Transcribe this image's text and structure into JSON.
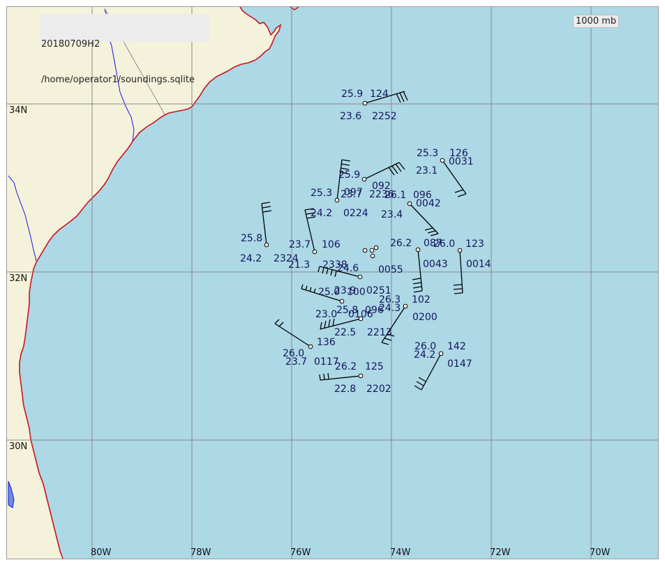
{
  "header": {
    "date_line": "20180709H2",
    "file_path": "/home/operator1/soundings.sqlite"
  },
  "level": "1000 mb",
  "colors": {
    "ocean": "#add8e6",
    "land": "#f5f2dc",
    "coast": "#c8141e",
    "river": "#1414e6",
    "grid": "#888888",
    "station_text": "#14145e",
    "wind_barb": "#000000"
  },
  "map": {
    "lon_labels": [
      "80W",
      "78W",
      "76W",
      "74W",
      "72W",
      "70W"
    ],
    "lat_labels": [
      "34N",
      "32N",
      "30N"
    ]
  },
  "stations": [
    {
      "temp": "25.9",
      "dew": "23.6",
      "code": "124",
      "time": "2252"
    },
    {
      "temp": "25.3",
      "dew": "23.1",
      "code": "126",
      "time": "0031"
    },
    {
      "temp": "25.9",
      "dew": "",
      "code": "092",
      "time": "2236"
    },
    {
      "temp": "25.3",
      "dew": "23.7",
      "code": "097",
      "time": ""
    },
    {
      "temp": "",
      "dew": "24.2",
      "code": "",
      "time": "0224"
    },
    {
      "temp": "26.1",
      "dew": "23.4",
      "code": "096",
      "time": "0042"
    },
    {
      "temp": "25.8",
      "dew": "24.2",
      "code": "",
      "time": "2324"
    },
    {
      "temp": "23.7",
      "dew": "21.3",
      "code": "106",
      "time": "2338"
    },
    {
      "temp": "26.2",
      "dew": "",
      "code": "087",
      "time": "0043"
    },
    {
      "temp": "26.0",
      "dew": "",
      "code": "123",
      "time": "0014"
    },
    {
      "temp": "",
      "dew": "24.6",
      "code": "",
      "time": "0055"
    },
    {
      "temp": "25.0",
      "dew": "23.9",
      "code": "100",
      "time": "0251"
    },
    {
      "temp": "26.3",
      "dew": "24.3",
      "code": "102",
      "time": "0200"
    },
    {
      "temp": "25.8",
      "dew": "23.0",
      "code": "096",
      "time": "0106"
    },
    {
      "temp": "",
      "dew": "22.5",
      "code": "",
      "time": "2213"
    },
    {
      "temp": "26.0",
      "dew": "23.7",
      "code": "136",
      "time": "0117"
    },
    {
      "temp": "26.0",
      "dew": "24.2",
      "code": "142",
      "time": "0147"
    },
    {
      "temp": "26.2",
      "dew": "22.8",
      "code": "125",
      "time": "2202"
    }
  ]
}
